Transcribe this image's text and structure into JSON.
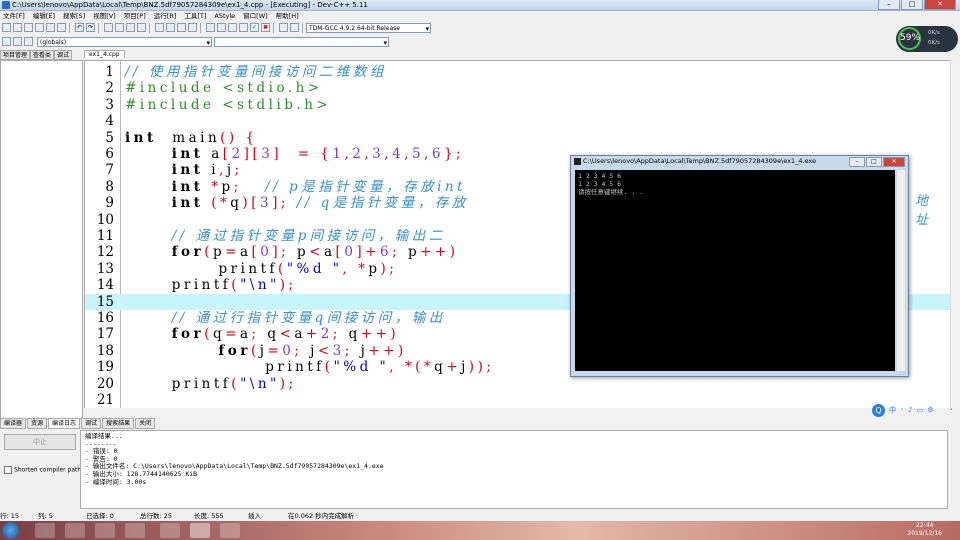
{
  "window": {
    "title": "C:\\Users\\lenovo\\AppData\\Local\\Temp\\BNZ.5df79057284309e\\ex1_4.cpp - [Executing] - Dev-C++ 5.11"
  },
  "menu": [
    "文件[F]",
    "编辑[E]",
    "搜索[S]",
    "视图[V]",
    "项目[P]",
    "运行[R]",
    "工具[T]",
    "AStyle",
    "窗口[W]",
    "帮助[H]"
  ],
  "toolbar": {
    "compiler_select": "TDM-GCC 4.9.2 64-bit Release",
    "scope_select": "(globals)"
  },
  "left_tabs": [
    "项目管理",
    "查看类",
    "调试"
  ],
  "file_tab": "ex1_4.cpp",
  "code": [
    {
      "n": "1",
      "text": "// 使用指针变量间接访问二维数组"
    },
    {
      "n": "2",
      "text": "#include <stdio.h>"
    },
    {
      "n": "3",
      "text": "#include <stdlib.h>"
    },
    {
      "n": "4",
      "text": ""
    },
    {
      "n": "5",
      "text": "int  main() {"
    },
    {
      "n": "6",
      "text": "      int a[2][3]  = {1,2,3,4,5,6};"
    },
    {
      "n": "7",
      "text": "      int i,j;"
    },
    {
      "n": "8",
      "text": "      int *p;   // p是指针变量，存放int"
    },
    {
      "n": "9",
      "text": "      int (*q)[3]; // q是指针变量，存放"
    },
    {
      "n": "10",
      "text": ""
    },
    {
      "n": "11",
      "text": "      // 通过指针变量p间接访问，输出二"
    },
    {
      "n": "12",
      "text": "      for(p=a[0]; p<a[0]+6; p++)"
    },
    {
      "n": "13",
      "text": "            printf(\"%d \", *p);"
    },
    {
      "n": "14",
      "text": "      printf(\"\\n\");"
    },
    {
      "n": "15",
      "text": ""
    },
    {
      "n": "16",
      "text": "      // 通过行指针变量q间接访问，输出"
    },
    {
      "n": "17",
      "text": "      for(q=a; q<a+2; q++)"
    },
    {
      "n": "18",
      "text": "            for(j=0; j<3; j++)"
    },
    {
      "n": "19",
      "text": "                  printf(\"%d \", *(*q+j));"
    },
    {
      "n": "20",
      "text": "      printf(\"\\n\");"
    },
    {
      "n": "21",
      "text": ""
    }
  ],
  "code_overflow_text": "地 址",
  "console": {
    "title": "C:\\Users\\lenovo\\AppData\\Local\\Temp\\BNZ.5df79057284309e\\ex1_4.exe",
    "lines": [
      "1 2 3 4 5 6",
      "1 2 3 4 5 6",
      "请按任意键继续. . ."
    ]
  },
  "bottom_tabs": [
    "编译器",
    "资源",
    "编译日志",
    "调试",
    "搜索结果",
    "关闭"
  ],
  "abort_label": "中止",
  "shorten_label": "Shorten compiler paths",
  "log_lines": [
    "编译结果...",
    "--------",
    "- 错误: 0",
    "- 警告: 0",
    "- 输出文件名: C:\\Users\\lenovo\\AppData\\Local\\Temp\\BNZ.5df79057284309e\\ex1_4.exe",
    "- 输出大小: 128.7744140625 KiB",
    "- 编译时间: 3.00s"
  ],
  "status": {
    "row": "行: 15",
    "col": "列: 5",
    "selected": "已选择: 0",
    "total": "总行数: 25",
    "length": "长度: 555",
    "mode": "插入",
    "parse": "在0.062 秒内完成解析"
  },
  "perf": {
    "pct": "59%",
    "up": "0K/s",
    "down": "0K/s"
  },
  "clock": {
    "time": "22:44",
    "date": "2019/12/16"
  },
  "ime": {
    "lang": "中"
  }
}
